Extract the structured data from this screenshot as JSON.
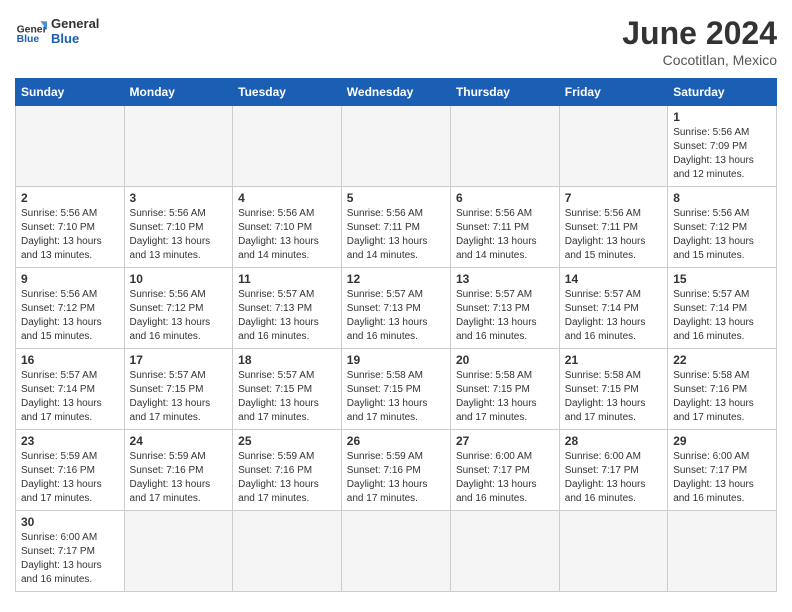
{
  "header": {
    "logo_general": "General",
    "logo_blue": "Blue",
    "month_title": "June 2024",
    "location": "Cocotitlan, Mexico"
  },
  "days_of_week": [
    "Sunday",
    "Monday",
    "Tuesday",
    "Wednesday",
    "Thursday",
    "Friday",
    "Saturday"
  ],
  "weeks": [
    [
      {
        "day": "",
        "info": ""
      },
      {
        "day": "",
        "info": ""
      },
      {
        "day": "",
        "info": ""
      },
      {
        "day": "",
        "info": ""
      },
      {
        "day": "",
        "info": ""
      },
      {
        "day": "",
        "info": ""
      },
      {
        "day": "1",
        "info": "Sunrise: 5:56 AM\nSunset: 7:09 PM\nDaylight: 13 hours\nand 12 minutes."
      }
    ],
    [
      {
        "day": "2",
        "info": "Sunrise: 5:56 AM\nSunset: 7:10 PM\nDaylight: 13 hours\nand 13 minutes."
      },
      {
        "day": "3",
        "info": "Sunrise: 5:56 AM\nSunset: 7:10 PM\nDaylight: 13 hours\nand 13 minutes."
      },
      {
        "day": "4",
        "info": "Sunrise: 5:56 AM\nSunset: 7:10 PM\nDaylight: 13 hours\nand 14 minutes."
      },
      {
        "day": "5",
        "info": "Sunrise: 5:56 AM\nSunset: 7:11 PM\nDaylight: 13 hours\nand 14 minutes."
      },
      {
        "day": "6",
        "info": "Sunrise: 5:56 AM\nSunset: 7:11 PM\nDaylight: 13 hours\nand 14 minutes."
      },
      {
        "day": "7",
        "info": "Sunrise: 5:56 AM\nSunset: 7:11 PM\nDaylight: 13 hours\nand 15 minutes."
      },
      {
        "day": "8",
        "info": "Sunrise: 5:56 AM\nSunset: 7:12 PM\nDaylight: 13 hours\nand 15 minutes."
      }
    ],
    [
      {
        "day": "9",
        "info": "Sunrise: 5:56 AM\nSunset: 7:12 PM\nDaylight: 13 hours\nand 15 minutes."
      },
      {
        "day": "10",
        "info": "Sunrise: 5:56 AM\nSunset: 7:12 PM\nDaylight: 13 hours\nand 16 minutes."
      },
      {
        "day": "11",
        "info": "Sunrise: 5:57 AM\nSunset: 7:13 PM\nDaylight: 13 hours\nand 16 minutes."
      },
      {
        "day": "12",
        "info": "Sunrise: 5:57 AM\nSunset: 7:13 PM\nDaylight: 13 hours\nand 16 minutes."
      },
      {
        "day": "13",
        "info": "Sunrise: 5:57 AM\nSunset: 7:13 PM\nDaylight: 13 hours\nand 16 minutes."
      },
      {
        "day": "14",
        "info": "Sunrise: 5:57 AM\nSunset: 7:14 PM\nDaylight: 13 hours\nand 16 minutes."
      },
      {
        "day": "15",
        "info": "Sunrise: 5:57 AM\nSunset: 7:14 PM\nDaylight: 13 hours\nand 16 minutes."
      }
    ],
    [
      {
        "day": "16",
        "info": "Sunrise: 5:57 AM\nSunset: 7:14 PM\nDaylight: 13 hours\nand 17 minutes."
      },
      {
        "day": "17",
        "info": "Sunrise: 5:57 AM\nSunset: 7:15 PM\nDaylight: 13 hours\nand 17 minutes."
      },
      {
        "day": "18",
        "info": "Sunrise: 5:57 AM\nSunset: 7:15 PM\nDaylight: 13 hours\nand 17 minutes."
      },
      {
        "day": "19",
        "info": "Sunrise: 5:58 AM\nSunset: 7:15 PM\nDaylight: 13 hours\nand 17 minutes."
      },
      {
        "day": "20",
        "info": "Sunrise: 5:58 AM\nSunset: 7:15 PM\nDaylight: 13 hours\nand 17 minutes."
      },
      {
        "day": "21",
        "info": "Sunrise: 5:58 AM\nSunset: 7:15 PM\nDaylight: 13 hours\nand 17 minutes."
      },
      {
        "day": "22",
        "info": "Sunrise: 5:58 AM\nSunset: 7:16 PM\nDaylight: 13 hours\nand 17 minutes."
      }
    ],
    [
      {
        "day": "23",
        "info": "Sunrise: 5:59 AM\nSunset: 7:16 PM\nDaylight: 13 hours\nand 17 minutes."
      },
      {
        "day": "24",
        "info": "Sunrise: 5:59 AM\nSunset: 7:16 PM\nDaylight: 13 hours\nand 17 minutes."
      },
      {
        "day": "25",
        "info": "Sunrise: 5:59 AM\nSunset: 7:16 PM\nDaylight: 13 hours\nand 17 minutes."
      },
      {
        "day": "26",
        "info": "Sunrise: 5:59 AM\nSunset: 7:16 PM\nDaylight: 13 hours\nand 17 minutes."
      },
      {
        "day": "27",
        "info": "Sunrise: 6:00 AM\nSunset: 7:17 PM\nDaylight: 13 hours\nand 16 minutes."
      },
      {
        "day": "28",
        "info": "Sunrise: 6:00 AM\nSunset: 7:17 PM\nDaylight: 13 hours\nand 16 minutes."
      },
      {
        "day": "29",
        "info": "Sunrise: 6:00 AM\nSunset: 7:17 PM\nDaylight: 13 hours\nand 16 minutes."
      }
    ],
    [
      {
        "day": "30",
        "info": "Sunrise: 6:00 AM\nSunset: 7:17 PM\nDaylight: 13 hours\nand 16 minutes."
      },
      {
        "day": "",
        "info": ""
      },
      {
        "day": "",
        "info": ""
      },
      {
        "day": "",
        "info": ""
      },
      {
        "day": "",
        "info": ""
      },
      {
        "day": "",
        "info": ""
      },
      {
        "day": "",
        "info": ""
      }
    ]
  ]
}
